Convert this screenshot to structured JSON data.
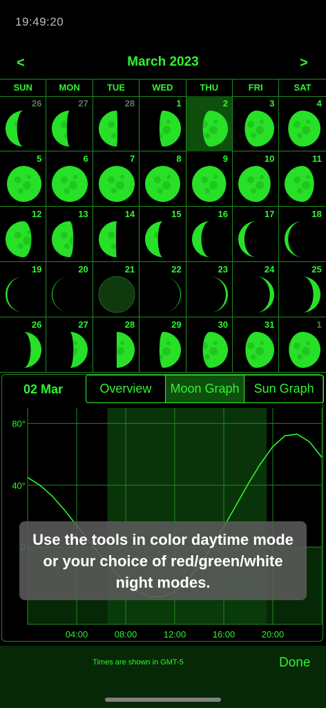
{
  "status_bar": {
    "time": "19:49:20"
  },
  "header": {
    "prev": "<",
    "next": ">",
    "title": "March 2023"
  },
  "calendar": {
    "weekdays": [
      "SUN",
      "MON",
      "TUE",
      "WED",
      "THU",
      "FRI",
      "SAT"
    ],
    "weeks": [
      [
        {
          "n": "26",
          "other": true,
          "phase": 0.32,
          "wax": false
        },
        {
          "n": "27",
          "other": true,
          "phase": 0.42,
          "wax": false
        },
        {
          "n": "28",
          "other": true,
          "phase": 0.52,
          "wax": false
        },
        {
          "n": "1",
          "phase": 0.6,
          "wax": true
        },
        {
          "n": "2",
          "phase": 0.7,
          "wax": true,
          "selected": true
        },
        {
          "n": "3",
          "phase": 0.82,
          "wax": true
        },
        {
          "n": "4",
          "phase": 0.9,
          "wax": true
        }
      ],
      [
        {
          "n": "5",
          "phase": 0.96,
          "wax": true
        },
        {
          "n": "6",
          "phase": 1.0,
          "wax": true
        },
        {
          "n": "7",
          "phase": 1.0,
          "wax": true
        },
        {
          "n": "8",
          "phase": 0.98,
          "wax": false
        },
        {
          "n": "9",
          "phase": 0.95,
          "wax": false
        },
        {
          "n": "10",
          "phase": 0.9,
          "wax": false
        },
        {
          "n": "11",
          "phase": 0.82,
          "wax": false
        }
      ],
      [
        {
          "n": "12",
          "phase": 0.72,
          "wax": false
        },
        {
          "n": "13",
          "phase": 0.6,
          "wax": false
        },
        {
          "n": "14",
          "phase": 0.48,
          "wax": false
        },
        {
          "n": "15",
          "phase": 0.36,
          "wax": false
        },
        {
          "n": "16",
          "phase": 0.26,
          "wax": false
        },
        {
          "n": "17",
          "phase": 0.17,
          "wax": false
        },
        {
          "n": "18",
          "phase": 0.1,
          "wax": false
        }
      ],
      [
        {
          "n": "19",
          "phase": 0.05,
          "wax": false
        },
        {
          "n": "20",
          "phase": 0.02,
          "wax": false
        },
        {
          "n": "21",
          "phase": 0,
          "wax": false,
          "new": true
        },
        {
          "n": "22",
          "phase": 0.02,
          "wax": true
        },
        {
          "n": "23",
          "phase": 0.06,
          "wax": true
        },
        {
          "n": "24",
          "phase": 0.12,
          "wax": true
        },
        {
          "n": "25",
          "phase": 0.2,
          "wax": true
        }
      ],
      [
        {
          "n": "26",
          "phase": 0.3,
          "wax": true
        },
        {
          "n": "27",
          "phase": 0.4,
          "wax": true
        },
        {
          "n": "28",
          "phase": 0.5,
          "wax": true
        },
        {
          "n": "29",
          "phase": 0.6,
          "wax": true
        },
        {
          "n": "30",
          "phase": 0.7,
          "wax": true
        },
        {
          "n": "31",
          "phase": 0.8,
          "wax": true
        },
        {
          "n": "1",
          "other": true,
          "phase": 0.88,
          "wax": true
        }
      ]
    ]
  },
  "detail": {
    "date": "02 Mar",
    "tabs": [
      "Overview",
      "Moon Graph",
      "Sun Graph"
    ],
    "active_tab": 1
  },
  "graph": {
    "y_labels": [
      "80°",
      "40°",
      "0"
    ],
    "x_labels": [
      "04:00",
      "08:00",
      "12:00",
      "16:00",
      "20:00"
    ],
    "daylight_hours": [
      6.5,
      19.5
    ],
    "moon_altitude": [
      [
        0,
        45
      ],
      [
        1,
        40
      ],
      [
        2,
        33
      ],
      [
        3,
        24
      ],
      [
        4,
        14
      ],
      [
        5,
        4
      ],
      [
        6,
        -6
      ],
      [
        7,
        -15
      ],
      [
        8,
        -23
      ],
      [
        9,
        -29
      ],
      [
        10,
        -32
      ],
      [
        11,
        -32
      ],
      [
        12,
        -29
      ],
      [
        13,
        -22
      ],
      [
        14,
        -12
      ],
      [
        15,
        0
      ],
      [
        16,
        13
      ],
      [
        17,
        27
      ],
      [
        18,
        41
      ],
      [
        19,
        54
      ],
      [
        20,
        65
      ],
      [
        21,
        72
      ],
      [
        22,
        73
      ],
      [
        23,
        68
      ],
      [
        24,
        58
      ]
    ],
    "y_range": [
      -50,
      90
    ],
    "colors": {
      "line": "#2ef52e",
      "grid": "#1f8a1f",
      "daylight": "#0b3d0b",
      "below_horizon": "#062806"
    }
  },
  "tooltip": {
    "text": "Use the tools in color daytime mode or your choice of red/green/white night modes."
  },
  "footer": {
    "note": "Times are shown in GMT-5",
    "done": "Done"
  },
  "colors": {
    "accent": "#2ef52e",
    "background": "#000000"
  }
}
